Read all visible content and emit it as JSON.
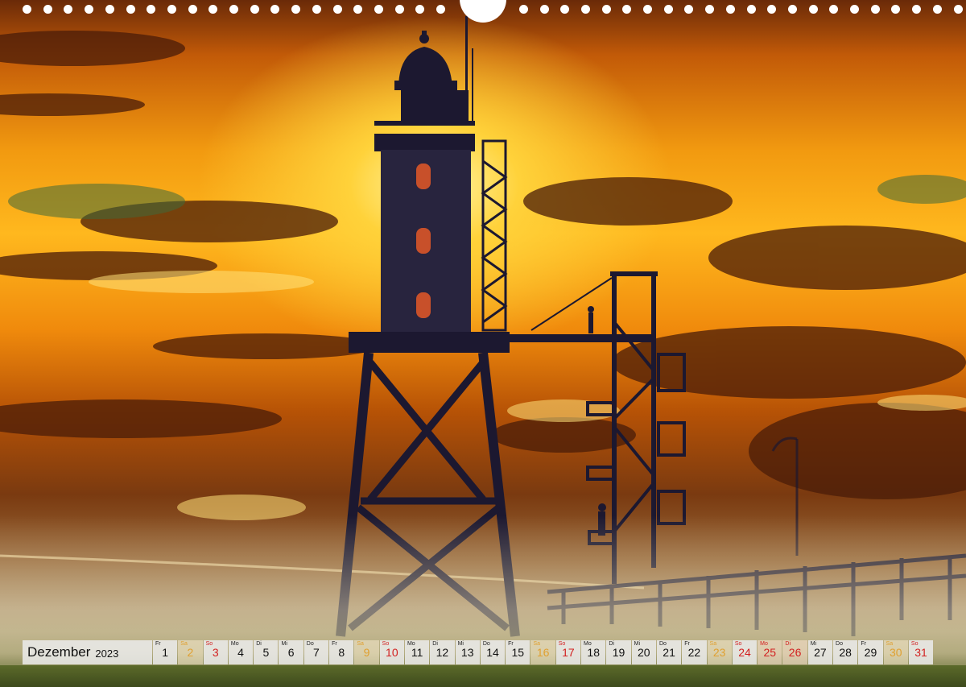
{
  "calendar": {
    "month": "Dezember",
    "year": "2023",
    "days": [
      {
        "wd": "Fr",
        "num": "1",
        "type": "weekday"
      },
      {
        "wd": "Sa",
        "num": "2",
        "type": "sat"
      },
      {
        "wd": "So",
        "num": "3",
        "type": "sun"
      },
      {
        "wd": "Mo",
        "num": "4",
        "type": "weekday"
      },
      {
        "wd": "Di",
        "num": "5",
        "type": "weekday"
      },
      {
        "wd": "Mi",
        "num": "6",
        "type": "weekday"
      },
      {
        "wd": "Do",
        "num": "7",
        "type": "weekday"
      },
      {
        "wd": "Fr",
        "num": "8",
        "type": "weekday"
      },
      {
        "wd": "Sa",
        "num": "9",
        "type": "sat"
      },
      {
        "wd": "So",
        "num": "10",
        "type": "sun"
      },
      {
        "wd": "Mo",
        "num": "11",
        "type": "weekday"
      },
      {
        "wd": "Di",
        "num": "12",
        "type": "weekday"
      },
      {
        "wd": "Mi",
        "num": "13",
        "type": "weekday"
      },
      {
        "wd": "Do",
        "num": "14",
        "type": "weekday"
      },
      {
        "wd": "Fr",
        "num": "15",
        "type": "weekday"
      },
      {
        "wd": "Sa",
        "num": "16",
        "type": "sat"
      },
      {
        "wd": "So",
        "num": "17",
        "type": "sun"
      },
      {
        "wd": "Mo",
        "num": "18",
        "type": "weekday"
      },
      {
        "wd": "Di",
        "num": "19",
        "type": "weekday"
      },
      {
        "wd": "Mi",
        "num": "20",
        "type": "weekday"
      },
      {
        "wd": "Do",
        "num": "21",
        "type": "weekday"
      },
      {
        "wd": "Fr",
        "num": "22",
        "type": "weekday"
      },
      {
        "wd": "Sa",
        "num": "23",
        "type": "sat"
      },
      {
        "wd": "So",
        "num": "24",
        "type": "sun"
      },
      {
        "wd": "Mo",
        "num": "25",
        "type": "hol"
      },
      {
        "wd": "Di",
        "num": "26",
        "type": "hol"
      },
      {
        "wd": "Mi",
        "num": "27",
        "type": "weekday"
      },
      {
        "wd": "Do",
        "num": "28",
        "type": "weekday"
      },
      {
        "wd": "Fr",
        "num": "29",
        "type": "weekday"
      },
      {
        "wd": "Sa",
        "num": "30",
        "type": "sat"
      },
      {
        "wd": "So",
        "num": "31",
        "type": "sun"
      }
    ]
  },
  "colors": {
    "sky_glow": "#ffd23a",
    "silhouette": "#1c1830",
    "saturday": "#e0a030",
    "sunday": "#d22020"
  },
  "photo": {
    "subject": "lighthouse-silhouette-at-sunset",
    "binding": "spiral-binding-holes"
  }
}
